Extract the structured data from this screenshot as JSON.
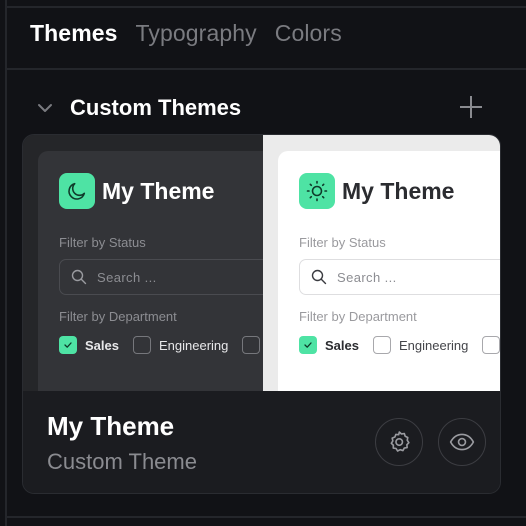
{
  "tabs": [
    {
      "label": "Themes",
      "active": true
    },
    {
      "label": "Typography",
      "active": false
    },
    {
      "label": "Colors",
      "active": false
    }
  ],
  "section": {
    "title": "Custom Themes",
    "collapse_icon": "chevron-down-icon",
    "add_icon": "plus-icon"
  },
  "theme_card": {
    "name": "My Theme",
    "type": "Custom Theme",
    "accent_color": "#4ee3a4",
    "preview_dark": {
      "icon": "moon-icon",
      "title": "My Theme",
      "status_label": "Filter by Status",
      "search_placeholder": "Search ...",
      "department_label": "Filter by Department",
      "checkboxes": [
        {
          "label": "Sales",
          "checked": true
        },
        {
          "label": "Engineering",
          "checked": false
        }
      ]
    },
    "preview_light": {
      "icon": "sun-icon",
      "title": "My Theme",
      "status_label": "Filter by Status",
      "search_placeholder": "Search ...",
      "department_label": "Filter by Department",
      "checkboxes": [
        {
          "label": "Sales",
          "checked": true
        },
        {
          "label": "Engineering",
          "checked": false
        }
      ]
    },
    "actions": [
      {
        "icon": "gear-icon",
        "label": "Settings"
      },
      {
        "icon": "eye-icon",
        "label": "Preview"
      }
    ]
  }
}
